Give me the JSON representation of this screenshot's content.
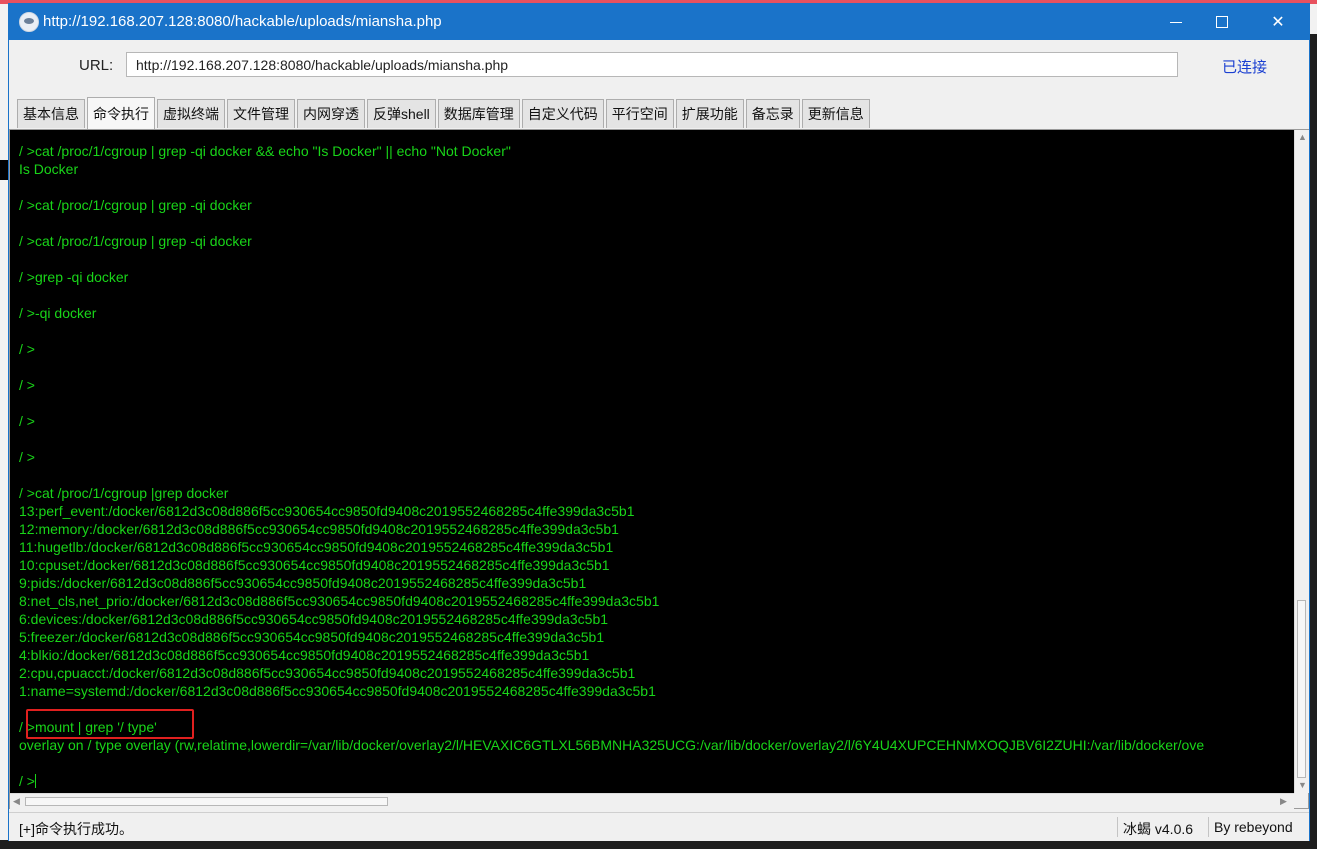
{
  "window": {
    "title": "http://192.168.207.128:8080/hackable/uploads/miansha.php"
  },
  "urlbar": {
    "label": "URL:",
    "value": "http://192.168.207.128:8080/hackable/uploads/miansha.php",
    "status": "已连接"
  },
  "tabs": [
    "基本信息",
    "命令执行",
    "虚拟终端",
    "文件管理",
    "内网穿透",
    "反弹shell",
    "数据库管理",
    "自定义代码",
    "平行空间",
    "扩展功能",
    "备忘录",
    "更新信息"
  ],
  "active_tab": "命令执行",
  "terminal": {
    "lines": [
      "/ >cat /proc/1/cgroup | grep -qi docker && echo \"Is Docker\" || echo \"Not Docker\"",
      "Is Docker",
      "",
      "/ >cat /proc/1/cgroup | grep -qi docker",
      "",
      "/ >cat /proc/1/cgroup | grep -qi docker",
      "",
      "/ >grep -qi docker",
      "",
      "/ >-qi docker",
      "",
      "/ >",
      "",
      "/ >",
      "",
      "/ >",
      "",
      "/ >",
      "",
      "/ >cat /proc/1/cgroup |grep docker",
      "13:perf_event:/docker/6812d3c08d886f5cc930654cc9850fd9408c2019552468285c4ffe399da3c5b1",
      "12:memory:/docker/6812d3c08d886f5cc930654cc9850fd9408c2019552468285c4ffe399da3c5b1",
      "11:hugetlb:/docker/6812d3c08d886f5cc930654cc9850fd9408c2019552468285c4ffe399da3c5b1",
      "10:cpuset:/docker/6812d3c08d886f5cc930654cc9850fd9408c2019552468285c4ffe399da3c5b1",
      "9:pids:/docker/6812d3c08d886f5cc930654cc9850fd9408c2019552468285c4ffe399da3c5b1",
      "8:net_cls,net_prio:/docker/6812d3c08d886f5cc930654cc9850fd9408c2019552468285c4ffe399da3c5b1",
      "6:devices:/docker/6812d3c08d886f5cc930654cc9850fd9408c2019552468285c4ffe399da3c5b1",
      "5:freezer:/docker/6812d3c08d886f5cc930654cc9850fd9408c2019552468285c4ffe399da3c5b1",
      "4:blkio:/docker/6812d3c08d886f5cc930654cc9850fd9408c2019552468285c4ffe399da3c5b1",
      "2:cpu,cpuacct:/docker/6812d3c08d886f5cc930654cc9850fd9408c2019552468285c4ffe399da3c5b1",
      "1:name=systemd:/docker/6812d3c08d886f5cc930654cc9850fd9408c2019552468285c4ffe399da3c5b1",
      "",
      "/ >mount | grep '/ type'",
      "overlay on / type overlay (rw,relatime,lowerdir=/var/lib/docker/overlay2/l/HEVAXIC6GTLXL56BMNHA325UCG:/var/lib/docker/overlay2/l/6Y4U4XUPCEHNMXOQJBV6I2ZUHI:/var/lib/docker/ove",
      "",
      "/ >"
    ]
  },
  "statusbar": {
    "message": "[+]命令执行成功。",
    "version": "冰蝎 v4.0.6",
    "author": "By rebeyond"
  },
  "colors": {
    "titlebar": "#1a73c9",
    "terminal_text": "#19d519",
    "terminal_bg": "#000000",
    "highlight": "#e0201f",
    "connected": "#1a3fd1"
  },
  "icons": {
    "app": "behinder-app-icon",
    "minimize": "minimize-icon",
    "maximize": "maximize-icon",
    "close": "close-icon"
  }
}
